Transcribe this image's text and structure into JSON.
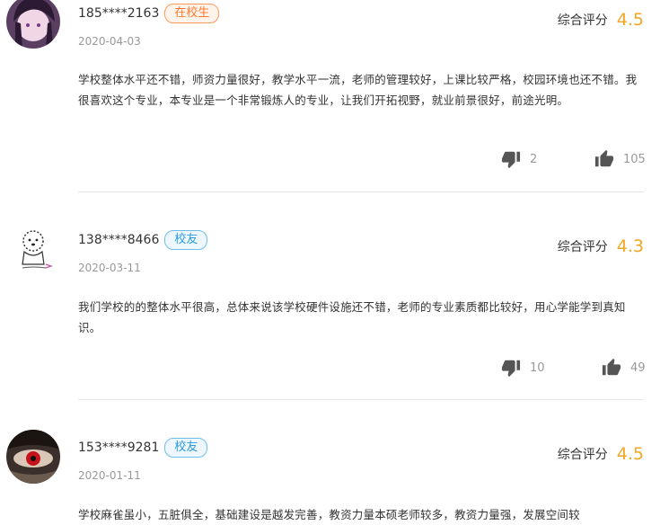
{
  "score_label": "综合评分",
  "reviews": [
    {
      "user": "185****2163",
      "badge": "在校生",
      "date": "2020-04-03",
      "score": "4.5",
      "content": "学校整体水平还不错，师资力量很好，教学水平一流，老师的管理较好，上课比较严格，校园环境也还不错。我很喜欢这个专业，本专业是一个非常锻炼人的专业，让我们开拓视野，就业前景很好，前途光明。",
      "dislikes": "2",
      "likes": "105"
    },
    {
      "user": "138****8466",
      "badge": "校友",
      "date": "2020-03-11",
      "score": "4.3",
      "content": "我们学校的的整体水平很高，总体来说该学校硬件设施还不错，老师的专业素质都比较好，用心学能学到真知识。",
      "dislikes": "10",
      "likes": "49"
    },
    {
      "user": "153****9281",
      "badge": "校友",
      "date": "2020-01-11",
      "score": "4.5",
      "content": "学校麻雀虽小，五脏俱全，基础建设是越发完善，教资力量本硕老师较多，教资力量强，发展空间较"
    }
  ],
  "icons": {
    "dislike": "thumbs-down-icon",
    "like": "thumbs-up-icon"
  },
  "colors": {
    "score": "#f5a623",
    "student_badge": "#ff7a2e",
    "alumni_badge": "#2b9bdc"
  }
}
